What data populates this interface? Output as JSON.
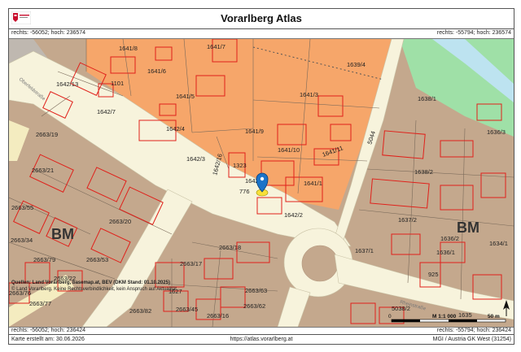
{
  "header": {
    "title": "Vorarlberg Atlas",
    "logo_icon": "vorarlberg-logo-icon"
  },
  "coords": {
    "top_left": "rechts: -56052; hoch: 236574",
    "top_right": "rechts: -55794; hoch: 236574",
    "bottom_left": "rechts: -56052; hoch: 236424",
    "bottom_right": "rechts: -55794; hoch: 236424"
  },
  "footer": {
    "created": "Karte erstellt am: 30.06.2026",
    "url": "https://atlas.vorarlberg.at",
    "crs": "MGI / Austria GK West (31254)"
  },
  "sources": {
    "line1": "Quellen: Land Vorarlberg, basemap.at, BEV (DKM Stand: 01.10.2025)",
    "line2": "© Land Vorarlberg. Keine Rechtsverbindlichkeit, kein Anspruch auf Aktualität"
  },
  "scale": {
    "ratio": "M 1:1 000",
    "start": "0",
    "end": "50 m"
  },
  "colors": {
    "residential": "#f6a66a",
    "mixed": "#c4a88d",
    "road": "#f7f3dc",
    "green": "#9fe0a7",
    "water": "#bde3f0",
    "parcel": "#e0201a"
  },
  "marker": {
    "icon": "location-pin-icon"
  },
  "north_icon": "north-arrow-icon",
  "labels": {
    "p1641_8": "1641/8",
    "p1641_6": "1641/6",
    "p1641_7": "1641/7",
    "p1639_4": "1639/4",
    "p1642_13": "1642/13",
    "p1101": "1101",
    "p1641_5": "1641/5",
    "p1641_3": "1641/3",
    "p1642_7": "1642/7",
    "p1642_4": "1642/4",
    "p1641_9": "1641/9",
    "p1638_1": "1638/1",
    "p2663_19": "2663/19",
    "p1641_10": "1641/10",
    "p1641_11": "1641/11",
    "p1636_3": "1636/3",
    "p2663_21": "2663/21",
    "p1642_3": "1642/3",
    "p1642_16": "1642/16",
    "p1323": "1323",
    "p1641_1": "1641/1",
    "p5044": "5044",
    "p1638_2": "1638/2",
    "p776": "776",
    "p1642": "1642",
    "p2663_55": "2663/55",
    "p2663_20": "2663/20",
    "p1642_2": "1642/2",
    "p1637_2": "1637/2",
    "p1636_2": "1636/2",
    "p1634_1": "1634/1",
    "p2663_34": "2663/34",
    "p2663_18": "2663/18",
    "p1637_1": "1637/1",
    "p1636_1": "1636/1",
    "p2663_79": "2663/79",
    "p2663_53": "2663/53",
    "p2663_17": "2663/17",
    "p925": "925",
    "p2663_22": "2663/22",
    "p1627": "1627",
    "p2663_63": "2663/63",
    "p5038_2": "5038/2",
    "p2663_76": "2663/76",
    "p2663_77": "2663/77",
    "p2663_62": "2663/62",
    "p2663_82": "2663/82",
    "p2663_45": "2663/45",
    "p2663_16": "2663/16",
    "p1635": "1635",
    "bm_left": "BM",
    "bm_right": "BM",
    "road_oben": "Oberfeldstraße",
    "road_right": "Rheinstraße"
  }
}
